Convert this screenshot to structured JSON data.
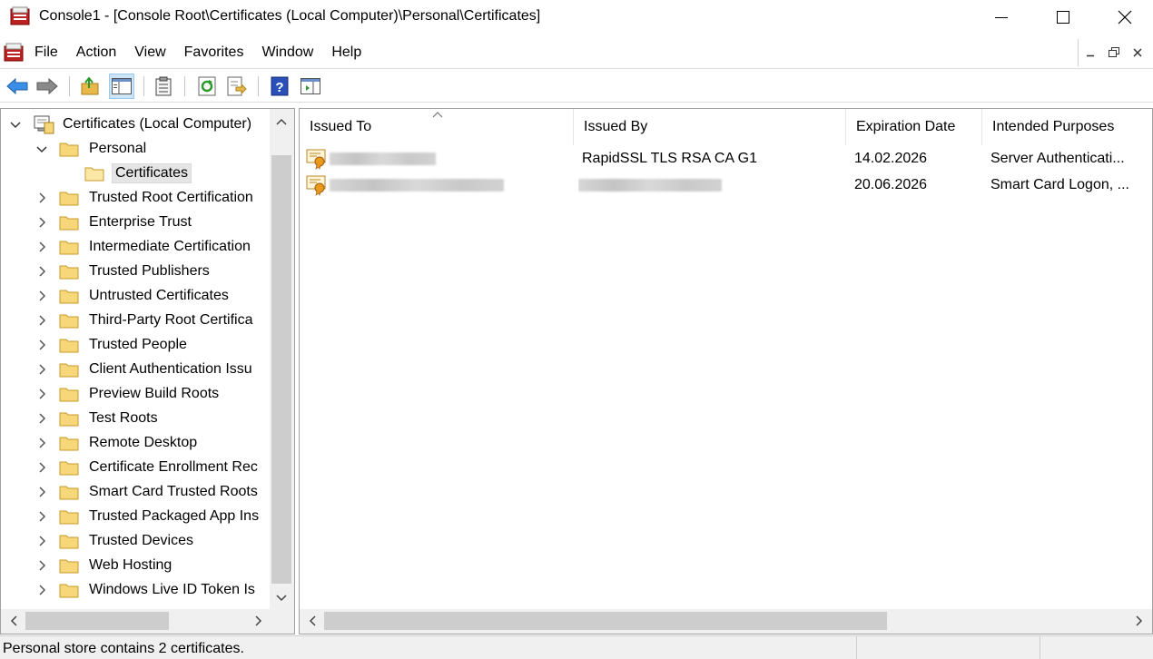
{
  "window": {
    "title": "Console1 - [Console Root\\Certificates (Local Computer)\\Personal\\Certificates]"
  },
  "menu": {
    "items": [
      "File",
      "Action",
      "View",
      "Favorites",
      "Window",
      "Help"
    ]
  },
  "toolbar": {
    "buttons": [
      "back-icon",
      "forward-icon",
      "up-folder-icon",
      "show-hide-tree-icon",
      "clipboard-icon",
      "refresh-icon",
      "export-list-icon",
      "help-icon",
      "show-action-pane-icon"
    ]
  },
  "tree": {
    "root": "Certificates (Local Computer)",
    "personal": "Personal",
    "selected_child": "Certificates",
    "stores": [
      "Trusted Root Certification",
      "Enterprise Trust",
      "Intermediate Certification",
      "Trusted Publishers",
      "Untrusted Certificates",
      "Third-Party Root Certifica",
      "Trusted People",
      "Client Authentication Issu",
      "Preview Build Roots",
      "Test Roots",
      "Remote Desktop",
      "Certificate Enrollment Rec",
      "Smart Card Trusted Roots",
      "Trusted Packaged App Ins",
      "Trusted Devices",
      "Web Hosting",
      "Windows Live ID Token Is"
    ]
  },
  "list": {
    "columns": [
      "Issued To",
      "Issued By",
      "Expiration Date",
      "Intended Purposes"
    ],
    "rows": [
      {
        "issued_to": "",
        "issued_by": "RapidSSL TLS RSA CA G1",
        "expiration": "14.02.2026",
        "purposes": "Server Authenticati..."
      },
      {
        "issued_to": "",
        "issued_by": "",
        "expiration": "20.06.2026",
        "purposes": "Smart Card Logon, ..."
      }
    ]
  },
  "status": {
    "text": "Personal store contains 2 certificates."
  }
}
